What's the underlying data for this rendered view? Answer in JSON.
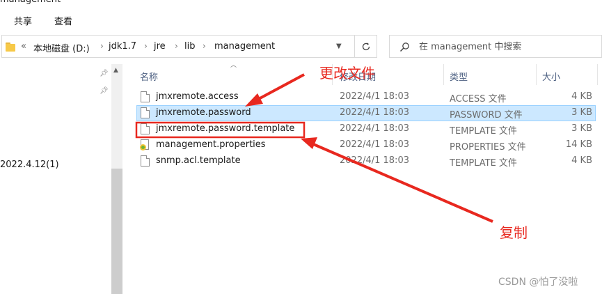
{
  "window": {
    "title": "management"
  },
  "ribbon": {
    "tabs": [
      "共享",
      "查看"
    ]
  },
  "address": {
    "overflow": "«",
    "crumbs": [
      "本地磁盘 (D:)",
      "jdk1.7",
      "jre",
      "lib",
      "management"
    ],
    "separator": "›"
  },
  "search": {
    "placeholder": "在 management 中搜索"
  },
  "nav": {
    "item": "2022.4.12(1)"
  },
  "columns": {
    "name": "名称",
    "date": "修改日期",
    "type": "类型",
    "size": "大小"
  },
  "files": [
    {
      "name": "jmxremote.access",
      "date": "2022/4/1 18:03",
      "type": "ACCESS 文件",
      "size": "4 KB",
      "icon": "file-icon"
    },
    {
      "name": "jmxremote.password",
      "date": "2022/4/1 18:03",
      "type": "PASSWORD 文件",
      "size": "3 KB",
      "icon": "file-icon",
      "selected": true
    },
    {
      "name": "jmxremote.password.template",
      "date": "2022/4/1 18:03",
      "type": "TEMPLATE 文件",
      "size": "3 KB",
      "icon": "file-icon"
    },
    {
      "name": "management.properties",
      "date": "2022/4/1 18:03",
      "type": "PROPERTIES 文件",
      "size": "14 KB",
      "icon": "properties-file-icon"
    },
    {
      "name": "snmp.acl.template",
      "date": "2022/4/1 18:03",
      "type": "TEMPLATE 文件",
      "size": "4 KB",
      "icon": "file-icon"
    }
  ],
  "annotations": {
    "rename": "更改文件",
    "copy": "复制",
    "color": "#e8281f"
  },
  "watermark": "CSDN @怕了没啦",
  "colors": {
    "selection": "#cce8ff",
    "header_text": "#4d6082"
  }
}
